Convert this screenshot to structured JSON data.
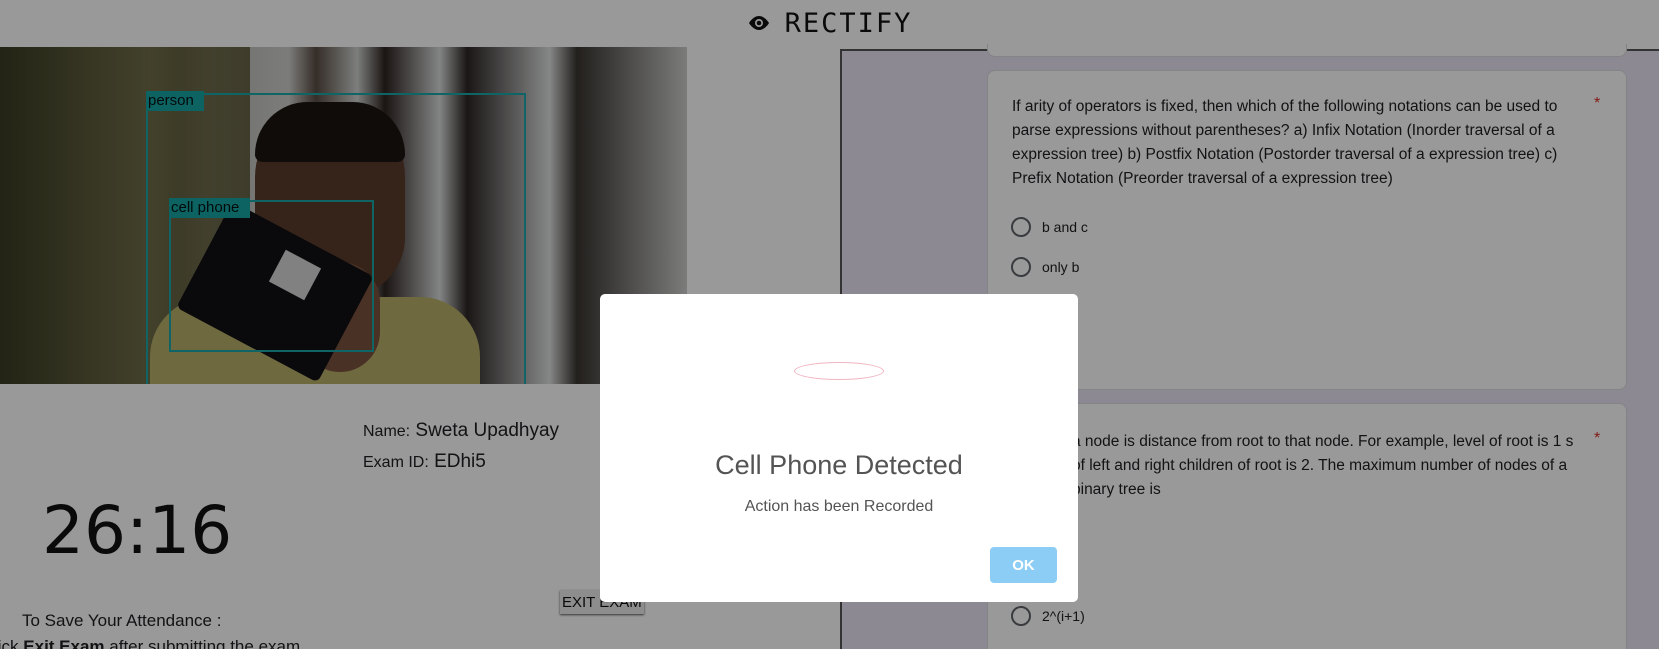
{
  "app": {
    "title": "RECTIFY",
    "icon": "eye-icon"
  },
  "webcam": {
    "detections": [
      {
        "label": "person"
      },
      {
        "label": "cell phone"
      }
    ]
  },
  "candidate": {
    "name_label": "Name:",
    "name": "Sweta Upadhyay",
    "exam_id_label": "Exam ID:",
    "exam_id": "EDhi5"
  },
  "timer": "26:16",
  "exit_button": "EXIT EXAM",
  "attendance": {
    "heading": "To Save Your Attendance :",
    "prefix": "lick ",
    "bold": "Exit Exam",
    "suffix": " after submitting the exam"
  },
  "questions": [
    {
      "text": "If arity of operators is fixed, then which of the following notations can be used to parse expressions without parentheses? a) Infix Notation (Inorder traversal of a expression tree) b) Postfix Notation (Postorder traversal of a expression tree) c) Prefix Notation (Preorder traversal of a expression tree)",
      "required": "*",
      "options": [
        "b and c",
        "only b"
      ]
    },
    {
      "text": "a node is distance from root to that node. For example, level of root is 1 s of left and right children of root is 2. The maximum number of nodes of a binary tree is",
      "required": "*",
      "options": [
        ")",
        "2^(i+1)"
      ]
    }
  ],
  "modal": {
    "title": "Cell Phone Detected",
    "text": "Action has been Recorded",
    "ok": "OK"
  },
  "colors": {
    "bbox": "#1aa8a8",
    "ok_button": "#8ccdf5",
    "form_bg": "#ebe4f4",
    "required": "#d93025"
  }
}
